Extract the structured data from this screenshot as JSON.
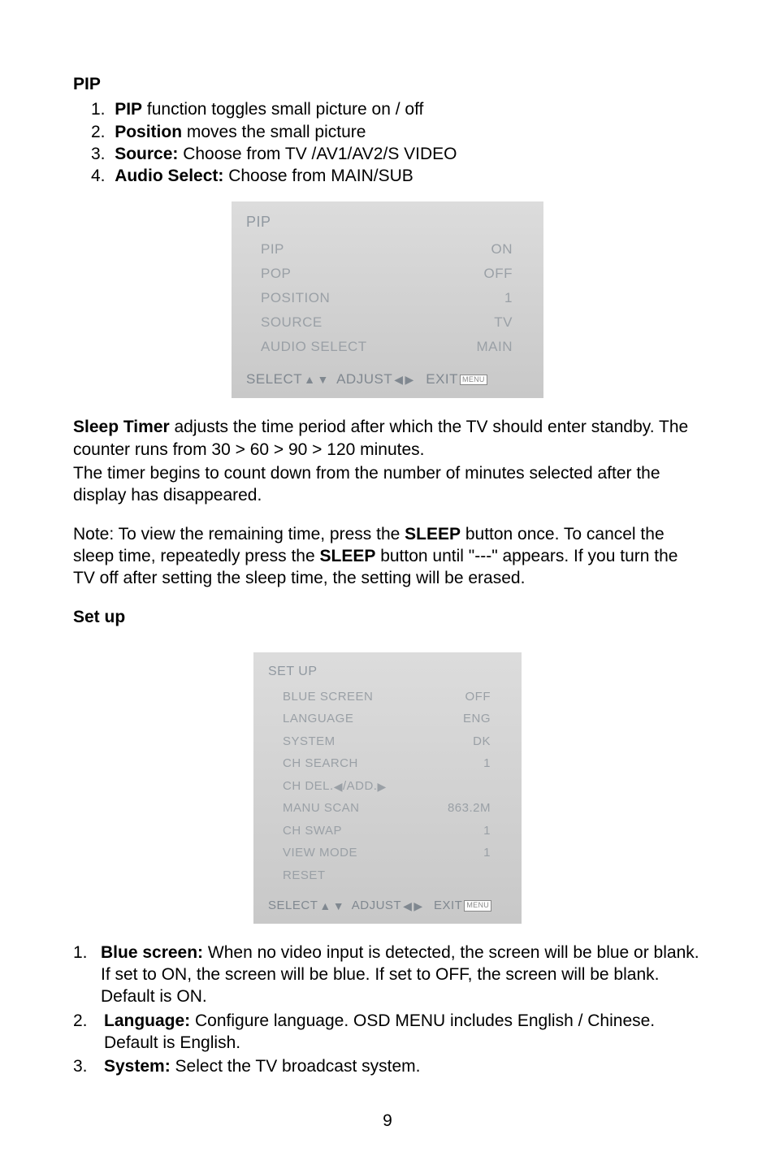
{
  "pip": {
    "heading": "PIP",
    "items": [
      {
        "num": "1.",
        "bold": "PIP",
        "tail": " function toggles small picture on / off"
      },
      {
        "num": "2.",
        "bold": "Position",
        "tail": " moves the small picture"
      },
      {
        "num": "3.",
        "bold": "Source:",
        "tail": " Choose from TV /AV1/AV2/S VIDEO"
      },
      {
        "num": "4.",
        "bold": "Audio Select:",
        "tail": " Choose from MAIN/SUB"
      }
    ]
  },
  "osd_pip": {
    "title": "PIP",
    "rows": [
      {
        "label": "PIP",
        "value": "ON"
      },
      {
        "label": "POP",
        "value": "OFF"
      },
      {
        "label": "POSITION",
        "value": "1"
      },
      {
        "label": "SOURCE",
        "value": "TV"
      },
      {
        "label": "AUDIO SELECT",
        "value": "MAIN"
      }
    ],
    "footer": {
      "select": "SELECT",
      "adjust": "ADJUST",
      "exit": "EXIT",
      "menu": "MENU"
    }
  },
  "sleep": {
    "p1_a": "Sleep Timer",
    "p1_b": " adjusts the time period after which the TV should enter standby. The counter runs from 30 > 60 > 90 > 120 minutes.",
    "p2": "The timer begins to count down from the number of minutes selected after the display has disappeared.",
    "note_a": "Note: To view the remaining time, press the ",
    "note_b": "SLEEP",
    "note_c": " button once. To cancel the sleep time, repeatedly press the ",
    "note_d": "SLEEP",
    "note_e": " button until \"---\" appears. If you turn the TV off after setting the sleep time, the setting will be erased."
  },
  "setup_heading": "Set up",
  "osd_setup": {
    "title": "SET UP",
    "rows": [
      {
        "label": "BLUE SCREEN",
        "value": "OFF"
      },
      {
        "label": "LANGUAGE",
        "value": "ENG"
      },
      {
        "label": "SYSTEM",
        "value": "DK"
      },
      {
        "label": "CH SEARCH",
        "value": "1"
      }
    ],
    "chdel": "CH DEL.",
    "chadd": "/ADD.",
    "rows2": [
      {
        "label": "MANU SCAN",
        "value": "863.2M"
      },
      {
        "label": "CH SWAP",
        "value": "1"
      },
      {
        "label": "VIEW MODE",
        "value": "1"
      },
      {
        "label": "RESET",
        "value": ""
      }
    ],
    "footer": {
      "select": "SELECT",
      "adjust": "ADJUST",
      "exit": "EXIT",
      "menu": "MENU"
    }
  },
  "setup_desc": {
    "items": [
      {
        "num": "1.",
        "bold": "Blue screen:",
        "tail": " When no video input is detected, the screen will be blue or blank. If set to ON, the screen will be blue. If set to OFF, the screen will be blank. Default is ON."
      },
      {
        "num": "2.",
        "bold": "Language:",
        "tail": " Configure language. OSD MENU includes English / Chinese. Default is English."
      },
      {
        "num": "3.",
        "bold": "System:",
        "tail": " Select the TV broadcast system."
      }
    ]
  },
  "page_num": "9"
}
